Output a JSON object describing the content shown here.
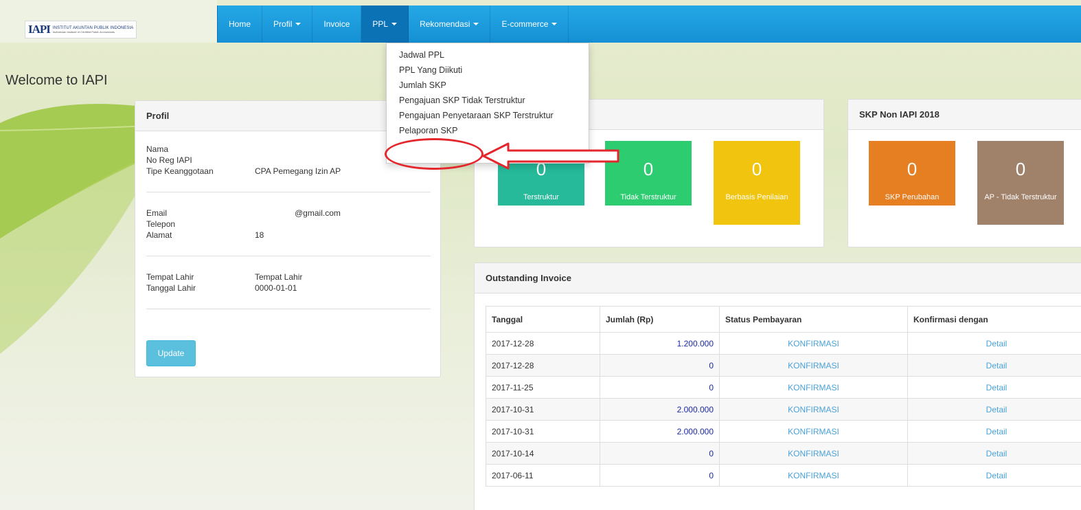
{
  "brand": {
    "logo_mark": "IAPI",
    "name": "INSTITUT AKUNTAN PUBLIK INDONESIA",
    "tagline": "Indonesian Institute of Certified Public Accountants"
  },
  "nav": {
    "items": [
      {
        "label": "Home"
      },
      {
        "label": "Profil"
      },
      {
        "label": "Invoice"
      },
      {
        "label": "PPL"
      },
      {
        "label": "Rekomendasi"
      },
      {
        "label": "E-commerce"
      }
    ]
  },
  "ppl_menu": {
    "items": [
      {
        "label": "Jadwal PPL"
      },
      {
        "label": "PPL Yang Diikuti"
      },
      {
        "label": "Jumlah SKP"
      },
      {
        "label": "Pengajuan SKP Tidak Terstruktur"
      },
      {
        "label": "Pengajuan Penyetaraan SKP Terstruktur"
      },
      {
        "label": "Pelaporan SKP"
      }
    ]
  },
  "page": {
    "welcome": "Welcome to IAPI"
  },
  "profil": {
    "title": "Profil",
    "rows_a": [
      {
        "label": "Nama",
        "value": ""
      },
      {
        "label": "No Reg IAPI",
        "value": ""
      },
      {
        "label": "Tipe Keanggotaan",
        "value": "CPA Pemegang Izin AP"
      }
    ],
    "rows_b": [
      {
        "label": "Email",
        "value": "@gmail.com"
      },
      {
        "label": "Telepon",
        "value": ""
      },
      {
        "label": "Alamat",
        "value": "18"
      }
    ],
    "rows_c": [
      {
        "label": "Tempat Lahir",
        "value": "Tempat Lahir"
      },
      {
        "label": "Tanggal Lahir",
        "value": "0000-01-01"
      }
    ],
    "update_label": "Update"
  },
  "skp": {
    "tiles": [
      {
        "value": "0",
        "label": "Terstruktur",
        "color": "#26b99a"
      },
      {
        "value": "0",
        "label": "Tidak Terstruktur",
        "color": "#2ecc71"
      },
      {
        "value": "0",
        "label": "Berbasis Penilaian",
        "color": "#f1c40f"
      }
    ]
  },
  "skp_non": {
    "title": "SKP Non IAPI 2018",
    "tiles": [
      {
        "value": "0",
        "label": "SKP Perubahan",
        "color": "#e67e22"
      },
      {
        "value": "0",
        "label": "AP - Tidak Terstruktur",
        "color": "#a0816a"
      }
    ]
  },
  "invoice": {
    "title": "Outstanding Invoice",
    "columns": [
      "Tanggal",
      "Jumlah (Rp)",
      "Status Pembayaran",
      "Konfirmasi dengan"
    ],
    "rows": [
      {
        "tanggal": "2017-12-28",
        "jumlah": "1.200.000",
        "status": "KONFIRMASI",
        "konfirmasi": "Detail"
      },
      {
        "tanggal": "2017-12-28",
        "jumlah": "0",
        "status": "KONFIRMASI",
        "konfirmasi": "Detail"
      },
      {
        "tanggal": "2017-11-25",
        "jumlah": "0",
        "status": "KONFIRMASI",
        "konfirmasi": "Detail"
      },
      {
        "tanggal": "2017-10-31",
        "jumlah": "2.000.000",
        "status": "KONFIRMASI",
        "konfirmasi": "Detail"
      },
      {
        "tanggal": "2017-10-31",
        "jumlah": "2.000.000",
        "status": "KONFIRMASI",
        "konfirmasi": "Detail"
      },
      {
        "tanggal": "2017-10-14",
        "jumlah": "0",
        "status": "KONFIRMASI",
        "konfirmasi": "Detail"
      },
      {
        "tanggal": "2017-06-11",
        "jumlah": "0",
        "status": "KONFIRMASI",
        "konfirmasi": "Detail"
      }
    ]
  }
}
